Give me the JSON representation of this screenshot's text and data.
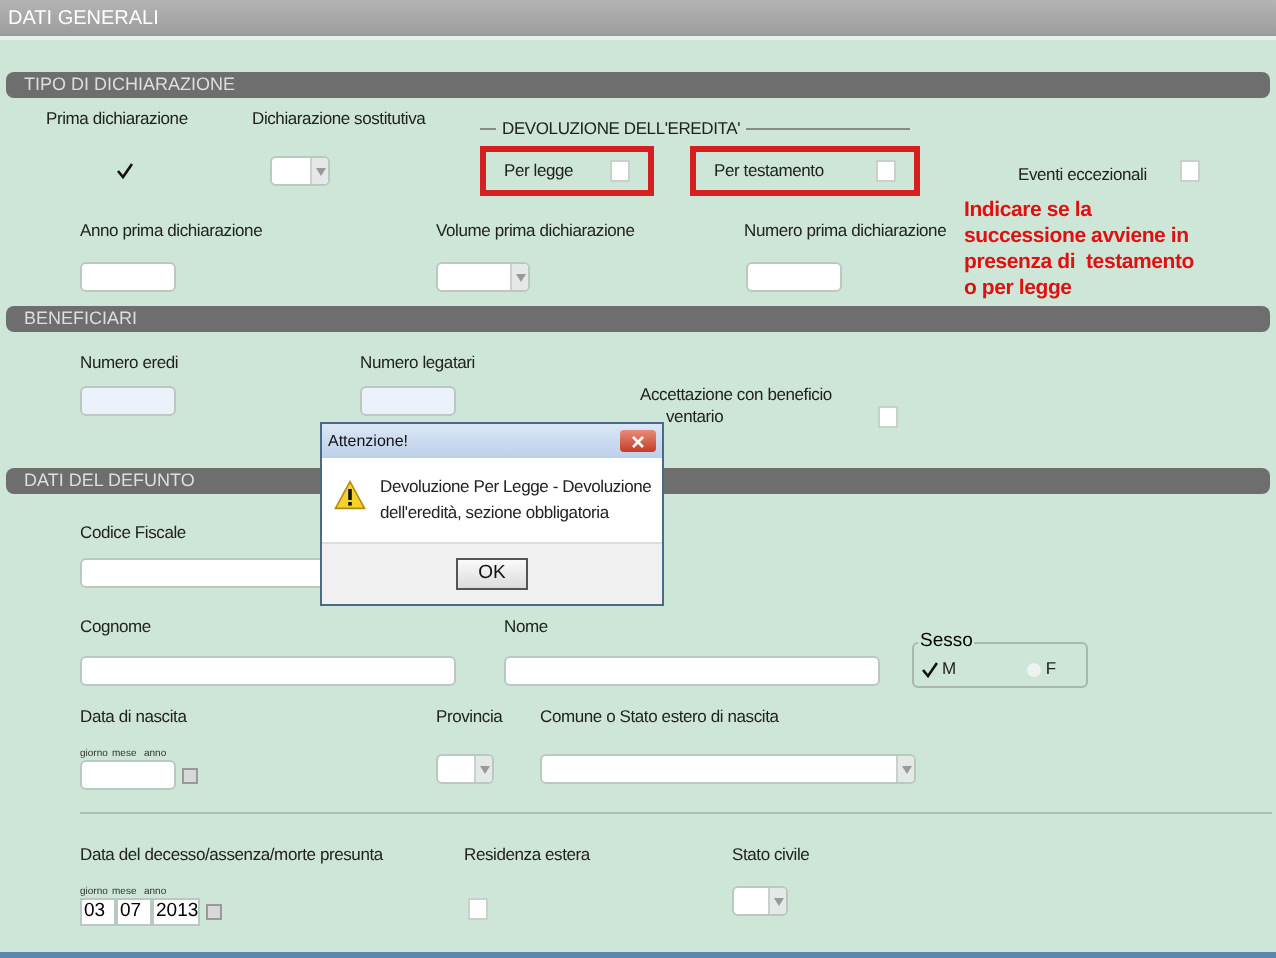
{
  "header": {
    "title": "DATI GENERALI"
  },
  "tipo": {
    "title": "TIPO DI DICHIARAZIONE",
    "prima": {
      "label": "Prima dichiarazione",
      "checked": true
    },
    "sostitutiva": {
      "label": "Dichiarazione sostitutiva"
    },
    "devoluzione": {
      "title": "DEVOLUZIONE DELL'EREDITA'",
      "options": [
        {
          "label": "Per legge",
          "checked": false,
          "highlighted": true
        },
        {
          "label": "Per testamento",
          "checked": false,
          "highlighted": true
        }
      ]
    },
    "eventi": {
      "label": "Eventi eccezionali",
      "checked": false
    },
    "anno": {
      "label": "Anno prima dichiarazione"
    },
    "volume": {
      "label": "Volume prima dichiarazione"
    },
    "numero": {
      "label": "Numero prima dichiarazione"
    },
    "annotation": [
      "Indicare se la",
      "successione avviene in",
      "presenza di  testamento",
      "o per legge"
    ]
  },
  "beneficiari": {
    "title": "BENEFICIARI",
    "eredi": {
      "label": "Numero eredi"
    },
    "legatari": {
      "label": "Numero legatari"
    },
    "accettazione": {
      "lines": [
        "Accettazione con beneficio",
        "ventario"
      ],
      "checked": false
    }
  },
  "defunto": {
    "title": "DATI DEL DEFUNTO",
    "codice": {
      "label": "Codice Fiscale"
    },
    "cognome": {
      "label": "Cognome"
    },
    "nome": {
      "label": "Nome"
    },
    "sesso": {
      "label": "Sesso",
      "options": [
        {
          "label": "M",
          "selected": true
        },
        {
          "label": "F",
          "selected": false
        }
      ]
    },
    "nascita": {
      "label": "Data di nascita",
      "parts": [
        "giorno",
        "mese",
        "anno"
      ]
    },
    "provincia": {
      "label": "Provincia"
    },
    "comune": {
      "label": "Comune o Stato estero di nascita"
    },
    "decesso": {
      "label": "Data del decesso/assenza/morte presunta",
      "parts": [
        "giorno",
        "mese",
        "anno"
      ],
      "values": [
        "03",
        "07",
        "2013"
      ]
    },
    "residenza": {
      "label": "Residenza estera",
      "checked": false
    },
    "stato": {
      "label": "Stato civile"
    }
  },
  "dialog": {
    "title": "Attenzione!",
    "message": [
      "Devoluzione Per Legge - Devoluzione",
      "dell'eredità, sezione obbligatoria"
    ],
    "button": "OK"
  }
}
